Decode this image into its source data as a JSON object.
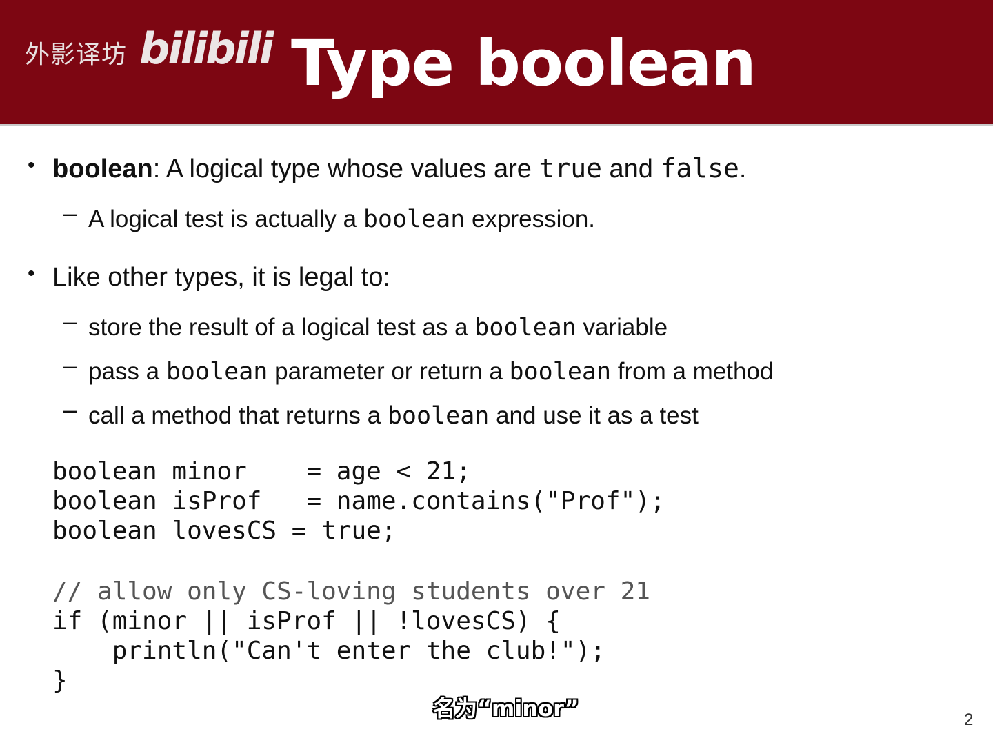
{
  "header": {
    "watermark_cn": "外影译坊",
    "watermark_logo": "bilibili",
    "title": "Type boolean",
    "bg_color": "#7d0612"
  },
  "bullet1": {
    "term": "boolean",
    "text_a": ": A logical type whose values are ",
    "code_true": "true",
    "text_b": " and ",
    "code_false": "false",
    "text_c": ".",
    "sub": {
      "text_a": "A logical test is actually a ",
      "code": "boolean",
      "text_b": " expression."
    }
  },
  "bullet2": {
    "text": "Like other types, it is legal to:",
    "subs": [
      {
        "text_a": "store the result of a logical test as a ",
        "code": "boolean",
        "text_b": " variable"
      },
      {
        "text_a": "pass a ",
        "code_a": "boolean",
        "text_b": " parameter or return a ",
        "code_b": "boolean",
        "text_c": " from a method"
      },
      {
        "text_a": "call a method that returns a ",
        "code": "boolean",
        "text_b": " and use it as a test"
      }
    ]
  },
  "code_block1": [
    "boolean minor    = age < 21;",
    "boolean isProf   = name.contains(\"Prof\");",
    "boolean lovesCS = true;"
  ],
  "code_block2": {
    "comment": "// allow only CS-loving students over 21",
    "lines": [
      "if (minor || isProf || !lovesCS) {",
      "    println(\"Can't enter the club!\");",
      "}"
    ]
  },
  "subtitle": "名为“minor”",
  "page_number": "2"
}
